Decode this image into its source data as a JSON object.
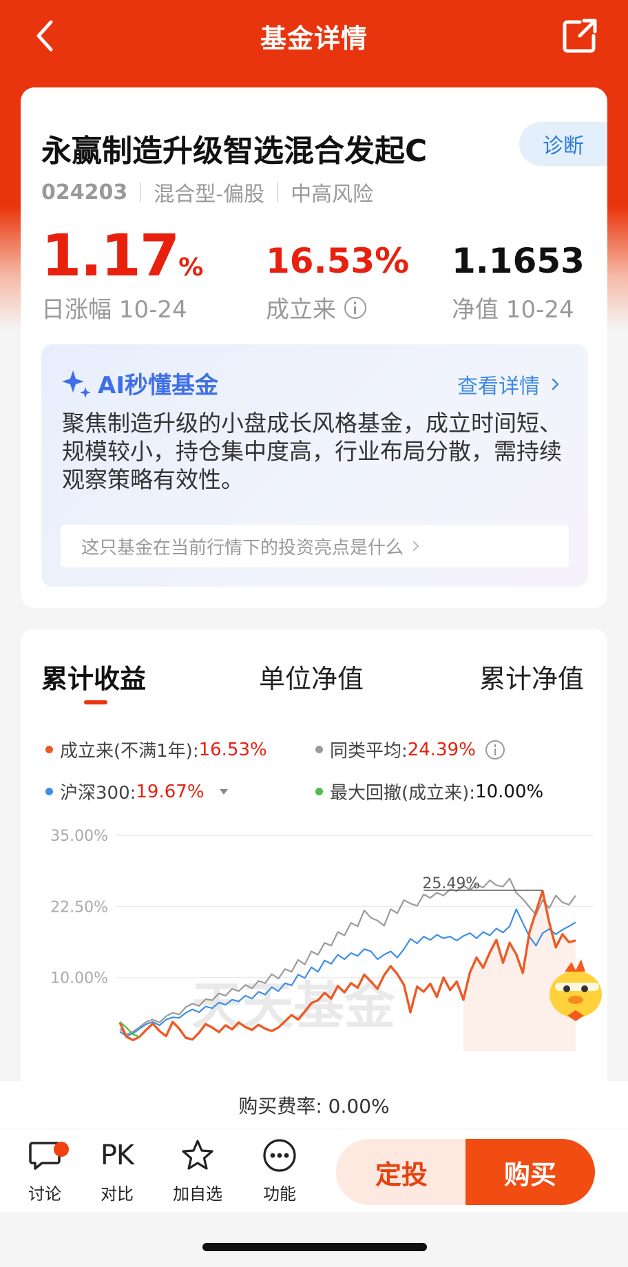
{
  "header": {
    "title": "基金详情"
  },
  "fund": {
    "name": "永赢制造升级智选混合发起C",
    "diagnose_label": "诊断",
    "code": "024203",
    "type": "混合型-偏股",
    "risk": "中高风险"
  },
  "stats": {
    "daily_change_value": "1.17",
    "daily_change_unit": "%",
    "daily_change_label": "日涨幅 10-24",
    "since_inception_value": "16.53%",
    "since_inception_label": "成立来",
    "nav_value": "1.1653",
    "nav_label": "净值 10-24"
  },
  "ai": {
    "title": "AI秒懂基金",
    "more": "查看详情",
    "summary": "聚焦制造升级的小盘成长风格基金，成立时间短、规模较小，持仓集中度高，行业布局分散，需持续观察策略有效性。",
    "question": "这只基金在当前行情下的投资亮点是什么"
  },
  "tabs": [
    {
      "label": "累计收益",
      "active": true
    },
    {
      "label": "单位净值",
      "active": false
    },
    {
      "label": "累计净值",
      "active": false
    }
  ],
  "legend": {
    "fund_label": "成立来(不满1年):",
    "fund_value": "16.53%",
    "peer_label": "同类平均:",
    "peer_value": "24.39%",
    "index_label": "沪深300:",
    "index_value": "19.67%",
    "drawdown_label": "最大回撤(成立来):",
    "drawdown_value": "10.00%"
  },
  "chart_data": {
    "type": "line",
    "y_ticks": [
      "35.00%",
      "22.50%",
      "10.00%"
    ],
    "ylim": [
      -3,
      35
    ],
    "annotation": "25.49%",
    "watermark": "天天基金",
    "colors": {
      "fund": "#ee5a24",
      "peer": "#9a9a9a",
      "index": "#3d8ee5",
      "drawdown": "#4cbe4c"
    },
    "series": [
      {
        "key": "fund",
        "values": [
          2.1,
          -0.4,
          -1.0,
          -0.4,
          0.8,
          1.9,
          0.6,
          -0.3,
          2.2,
          1.0,
          -0.6,
          -0.9,
          0.3,
          1.8,
          1.2,
          0.4,
          1.6,
          0.9,
          2.1,
          1.3,
          0.8,
          1.7,
          1.0,
          0.6,
          1.2,
          2.3,
          3.4,
          2.6,
          4.0,
          5.5,
          6.0,
          7.3,
          6.3,
          8.5,
          7.4,
          9.0,
          8.2,
          10.5,
          9.3,
          8.0,
          10.4,
          12.0,
          10.6,
          8.7,
          3.9,
          8.4,
          7.5,
          8.9,
          6.6,
          10.0,
          7.8,
          9.3,
          6.1,
          10.9,
          13.5,
          11.7,
          14.4,
          16.6,
          12.6,
          16.1,
          14.1,
          10.8,
          17.9,
          21.6,
          25.2,
          19.7,
          15.3,
          17.6,
          16.2,
          16.5
        ]
      },
      {
        "key": "peer",
        "values": [
          1.0,
          0.0,
          0.5,
          1.3,
          2.2,
          2.6,
          2.1,
          3.2,
          3.8,
          3.5,
          4.8,
          5.4,
          5.0,
          6.2,
          6.0,
          7.2,
          6.8,
          8.0,
          7.6,
          8.7,
          8.1,
          9.4,
          9.0,
          10.6,
          9.8,
          11.5,
          11.0,
          13.1,
          12.3,
          14.6,
          14.0,
          16.1,
          15.6,
          18.0,
          17.4,
          19.6,
          19.0,
          21.8,
          20.5,
          20.0,
          19.1,
          22.0,
          21.3,
          23.6,
          23.0,
          22.6,
          24.6,
          24.0,
          24.9,
          24.4,
          25.5,
          25.2,
          26.2,
          25.4,
          26.3,
          25.8,
          27.1,
          26.2,
          26.0,
          27.4,
          24.9,
          23.8,
          22.4,
          21.0,
          23.6,
          22.2,
          24.4,
          23.2,
          22.8,
          24.4
        ]
      },
      {
        "key": "index",
        "values": [
          0.5,
          -0.3,
          0.2,
          1.0,
          1.8,
          2.2,
          1.6,
          2.6,
          3.0,
          2.9,
          3.8,
          4.4,
          3.9,
          4.9,
          4.6,
          5.6,
          5.2,
          6.1,
          5.8,
          6.8,
          6.3,
          7.5,
          7.0,
          8.3,
          7.6,
          9.0,
          8.6,
          10.5,
          9.9,
          11.8,
          11.0,
          13.0,
          12.4,
          14.0,
          13.2,
          14.3,
          13.8,
          15.0,
          14.6,
          13.2,
          14.0,
          14.6,
          13.5,
          15.0,
          16.8,
          16.0,
          17.2,
          16.6,
          17.5,
          16.9,
          17.2,
          16.5,
          17.3,
          17.8,
          16.9,
          18.0,
          17.4,
          18.6,
          17.9,
          19.0,
          22.0,
          19.6,
          17.2,
          15.6,
          17.8,
          18.5,
          17.6,
          18.4,
          19.0,
          19.7
        ]
      },
      {
        "key": "drawdown",
        "values": [
          2.2,
          1.2,
          0.0,
          -0.4
        ]
      }
    ]
  },
  "fee": {
    "text": "购买费率: 0.00%"
  },
  "bottom": {
    "discuss": "讨论",
    "pk_icon": "PK",
    "compare": "对比",
    "watchlist": "加自选",
    "more": "功能",
    "sip": "定投",
    "buy": "购买"
  }
}
